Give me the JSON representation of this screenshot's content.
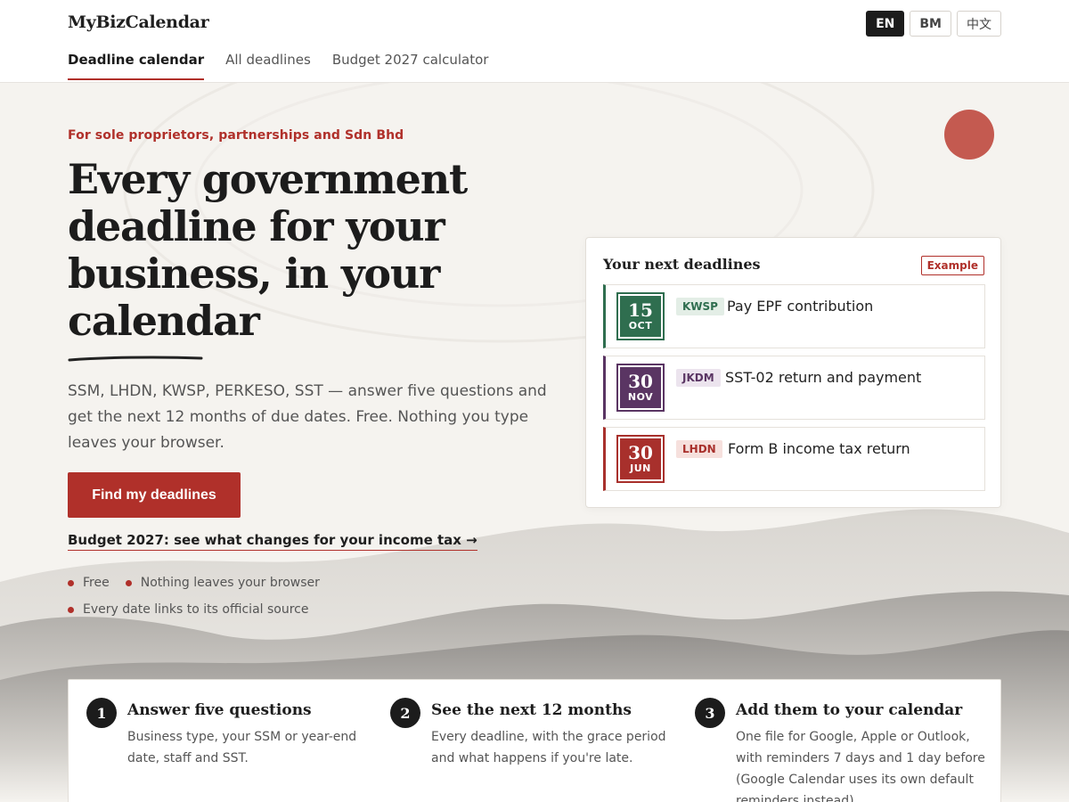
{
  "header": {
    "brand": "MyBizCalendar",
    "languages": [
      "EN",
      "BM",
      "中文"
    ],
    "active_language": "EN",
    "tabs": [
      "Deadline calendar",
      "All deadlines",
      "Budget 2027 calculator"
    ],
    "active_tab": "Deadline calendar"
  },
  "hero": {
    "kicker": "For sole proprietors, partnerships and Sdn Bhd",
    "headline": "Every government deadline for your business, in your calendar",
    "lead": "SSM, LHDN, KWSP, PERKESO, SST — answer five questions and get the next 12 months of due dates. Free. Nothing you type leaves your browser.",
    "cta": "Find my deadlines",
    "budget_link": "Budget 2027: see what changes for your income tax →",
    "bullets": [
      "Free",
      "Nothing leaves your browser",
      "Every date links to its official source"
    ]
  },
  "deadlines_card": {
    "title": "Your next deadlines",
    "badge": "Example",
    "items": [
      {
        "day": "15",
        "month": "OCT",
        "agency": "KWSP",
        "text": "Pay EPF contribution",
        "color": "#2f6e4f",
        "tag_bg": "#e3eee6",
        "tag_fg": "#2f6e4f"
      },
      {
        "day": "30",
        "month": "NOV",
        "agency": "JKDM",
        "text": "SST-02 return and payment",
        "color": "#5a3563",
        "tag_bg": "#ece4ee",
        "tag_fg": "#5a3563"
      },
      {
        "day": "30",
        "month": "JUN",
        "agency": "LHDN",
        "text": "Form B income tax return",
        "color": "#a8302c",
        "tag_bg": "#f6e0dd",
        "tag_fg": "#a8302c"
      }
    ]
  },
  "steps": [
    {
      "num": "1",
      "title": "Answer five questions",
      "desc": "Business type, your SSM or year-end date, staff and SST."
    },
    {
      "num": "2",
      "title": "See the next 12 months",
      "desc": "Every deadline, with the grace period and what happens if you're late."
    },
    {
      "num": "3",
      "title": "Add them to your calendar",
      "desc": "One file for Google, Apple or Outlook, with reminders 7 days and 1 day before (Google Calendar uses its own default reminders instead)."
    }
  ]
}
